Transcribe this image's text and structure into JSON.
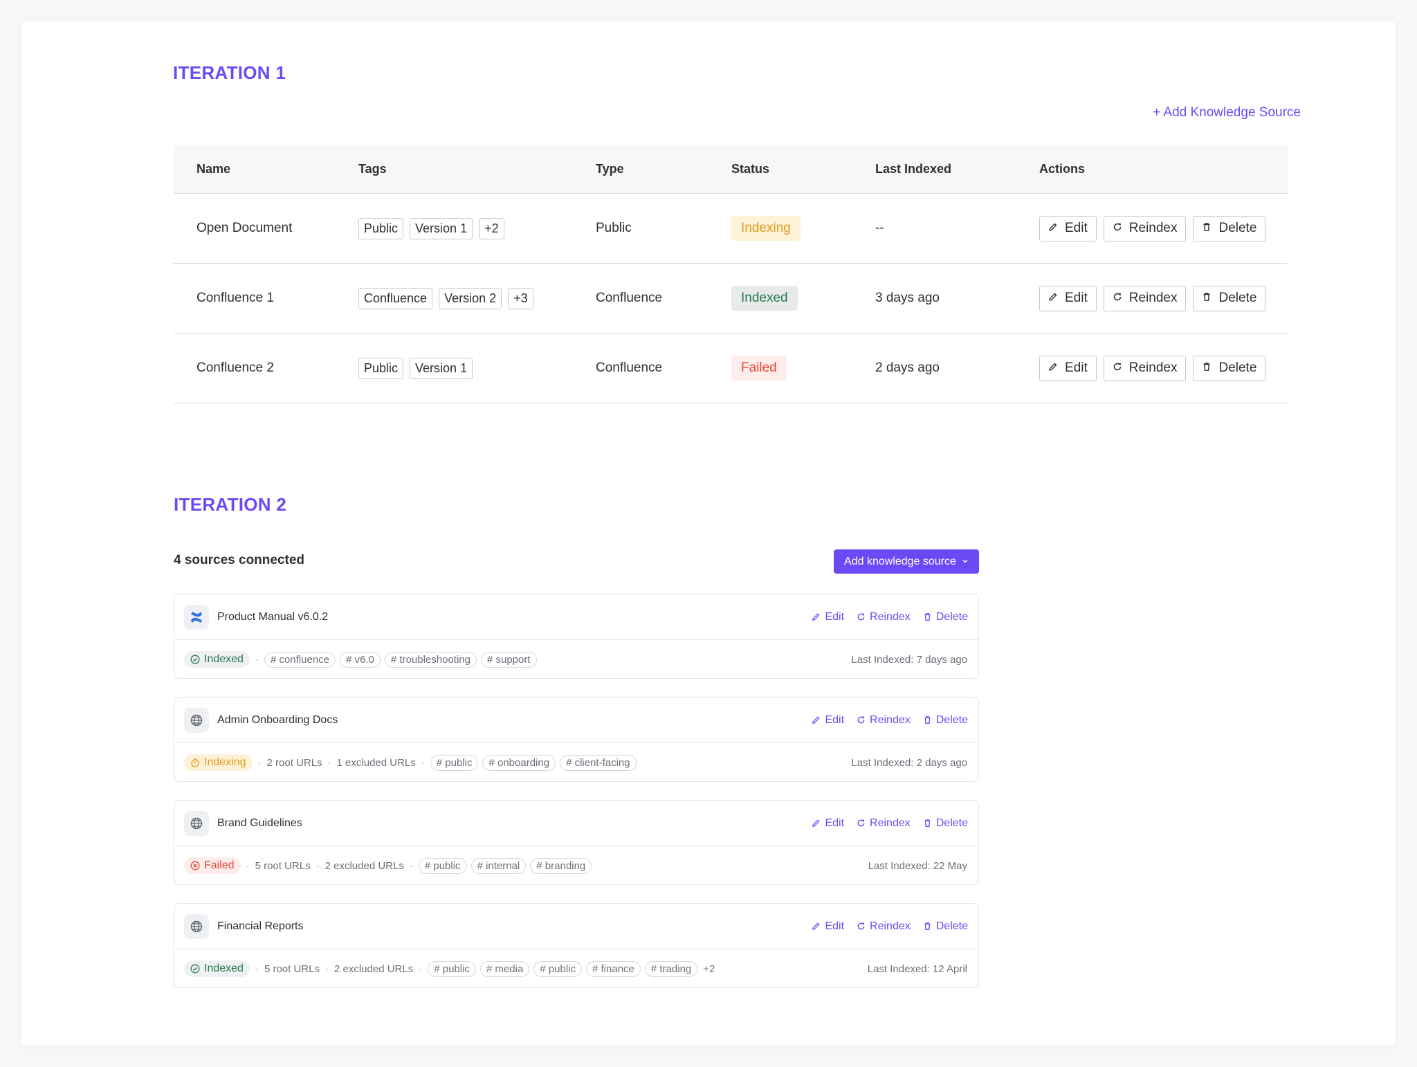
{
  "iteration1": {
    "title": "ITERATION 1",
    "add_link": "+ Add Knowledge Source",
    "headers": [
      "Name",
      "Tags",
      "Type",
      "Status",
      "Last Indexed",
      "Actions"
    ],
    "rows": [
      {
        "name": "Open Document",
        "tags": [
          "Public",
          "Version 1",
          "+2"
        ],
        "type": "Public",
        "status": "Indexing",
        "last": "--"
      },
      {
        "name": "Confluence 1",
        "tags": [
          "Confluence",
          "Version 2",
          "+3"
        ],
        "type": "Confluence",
        "status": "Indexed",
        "last": "3 days ago"
      },
      {
        "name": "Confluence 2",
        "tags": [
          "Public",
          "Version 1"
        ],
        "type": "Confluence",
        "status": "Failed",
        "last": "2 days ago"
      }
    ],
    "actions": {
      "edit": "Edit",
      "reindex": "Reindex",
      "delete": "Delete"
    }
  },
  "iteration2": {
    "title": "ITERATION 2",
    "count_label": "4 sources connected",
    "add_button": "Add knowledge source",
    "actions": {
      "edit": "Edit",
      "reindex": "Reindex",
      "delete": "Delete"
    },
    "sources": [
      {
        "name": "Product Manual v6.0.2",
        "icon": "confluence-icon",
        "status": "Indexed",
        "root_urls": "",
        "excluded_urls": "",
        "tags": [
          "# confluence",
          "# v6.0",
          "# troubleshooting",
          "# support"
        ],
        "more": "",
        "last": "Last Indexed: 7 days ago"
      },
      {
        "name": "Admin Onboarding Docs",
        "icon": "globe-icon",
        "status": "Indexing",
        "root_urls": "2 root URLs",
        "excluded_urls": "1 excluded URLs",
        "tags": [
          "# public",
          "# onboarding",
          "# client-facing"
        ],
        "more": "",
        "last": "Last Indexed: 2 days ago"
      },
      {
        "name": "Brand Guidelines",
        "icon": "globe-icon",
        "status": "Failed",
        "root_urls": "5 root URLs",
        "excluded_urls": "2 excluded URLs",
        "tags": [
          "# public",
          "# internal",
          "# branding"
        ],
        "more": "",
        "last": "Last Indexed: 22 May"
      },
      {
        "name": "Financial Reports",
        "icon": "globe-icon",
        "status": "Indexed",
        "root_urls": "5 root URLs",
        "excluded_urls": "2 excluded URLs",
        "tags": [
          "# public",
          "# media",
          "# public",
          "# finance",
          "# trading"
        ],
        "more": "+2",
        "last": "Last Indexed: 12 April"
      }
    ]
  },
  "colors": {
    "accent": "#6b4af5",
    "indexed": "#237a4b",
    "indexing": "#e39b1c",
    "failed": "#e4473a"
  }
}
